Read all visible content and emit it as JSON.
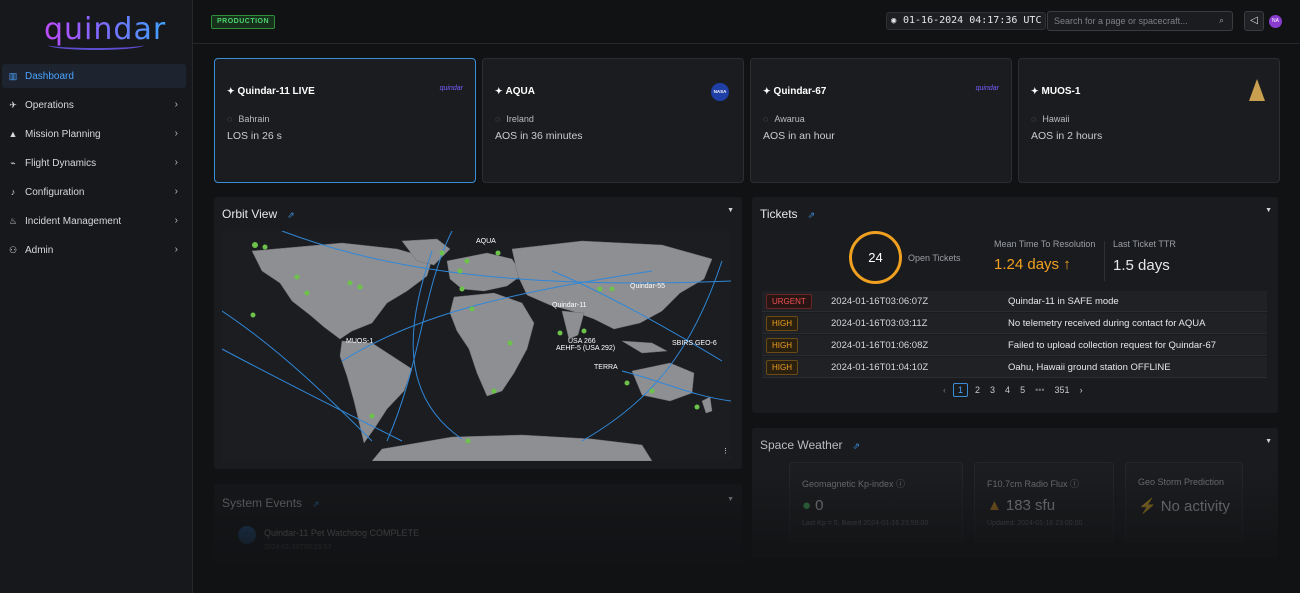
{
  "app": {
    "logo_text": "quindar"
  },
  "sidebar": {
    "items": [
      {
        "label": "Dashboard",
        "icon": "chart-icon",
        "active": true
      },
      {
        "label": "Operations",
        "icon": "rocket-icon"
      },
      {
        "label": "Mission Planning",
        "icon": "tent-icon"
      },
      {
        "label": "Flight Dynamics",
        "icon": "plane-icon"
      },
      {
        "label": "Configuration",
        "icon": "bell-icon"
      },
      {
        "label": "Incident Management",
        "icon": "flame-icon"
      },
      {
        "label": "Admin",
        "icon": "users-icon"
      }
    ]
  },
  "topbar": {
    "environment": "PRODUCTION",
    "clock": "01-16-2024 04:17:36 UTC",
    "search_placeholder": "Search for a page or spacecraft...",
    "avatar_initials": "NA"
  },
  "passes": [
    {
      "name": "Quindar-11 LIVE",
      "location": "Bahrain",
      "status": "LOS in 26 s",
      "brand": "quindar"
    },
    {
      "name": "AQUA",
      "location": "Ireland",
      "status": "AOS in 36 minutes",
      "brand": "NASA"
    },
    {
      "name": "Quindar-67",
      "location": "Awarua",
      "status": "AOS in an hour",
      "brand": "quindar"
    },
    {
      "name": "MUOS-1",
      "location": "Hawaii",
      "status": "AOS in 2 hours",
      "brand": ""
    }
  ],
  "orbit_view": {
    "title": "Orbit View",
    "labels": [
      "AQUA",
      "Quindar-55",
      "Quindar-11",
      "MUOS-1",
      "USA 266",
      "AEHF-5 (USA 292)",
      "SBIRS GEO-6",
      "TERRA"
    ]
  },
  "tickets": {
    "title": "Tickets",
    "open_count": "24",
    "open_label": "Open Tickets",
    "mttr_label": "Mean Time To Resolution",
    "mttr_value": "1.24 days ↑",
    "last_label": "Last Ticket TTR",
    "last_value": "1.5 days",
    "rows": [
      {
        "priority": "URGENT",
        "time": "2024-01-16T03:06:07Z",
        "description": "Quindar-11 in SAFE mode"
      },
      {
        "priority": "HIGH",
        "time": "2024-01-16T03:03:11Z",
        "description": "No telemetry received during contact for AQUA"
      },
      {
        "priority": "HIGH",
        "time": "2024-01-16T01:06:08Z",
        "description": "Failed to upload collection request for Quindar-67"
      },
      {
        "priority": "HIGH",
        "time": "2024-01-16T01:04:10Z",
        "description": "Oahu, Hawaii ground station OFFLINE"
      }
    ],
    "pager": {
      "prev": "‹",
      "pages": [
        "1",
        "2",
        "3",
        "4",
        "5",
        "•••",
        "351"
      ],
      "next": "›"
    }
  },
  "system_events": {
    "title": "System Events",
    "first_event": "Quindar-11 Pet Watchdog COMPLETE",
    "first_event_time": "2024-01-16T03:15:57"
  },
  "space_weather": {
    "title": "Space Weather",
    "cards": [
      {
        "label": "Geomagnetic Kp-index ⓘ",
        "value": "0",
        "sub": "Last Kp = 0, Based 2024-01-16 23:59:00"
      },
      {
        "label": "F10.7cm Radio Flux ⓘ",
        "value": "183 sfu",
        "sub": "Updated: 2024-01-16 23:00:00"
      },
      {
        "label": "Geo Storm Prediction",
        "value": "No activity",
        "sub": ""
      }
    ]
  },
  "colors": {
    "accent": "#3b8ed6",
    "warning": "#f0a020",
    "urgent": "#f05050",
    "good": "#4dd36b"
  }
}
